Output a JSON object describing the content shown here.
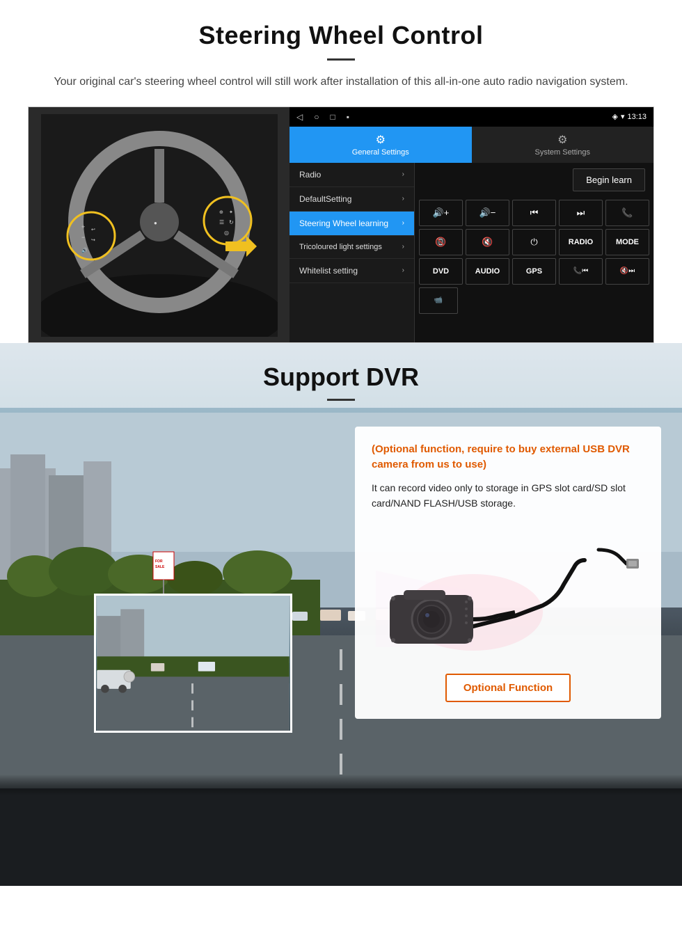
{
  "page": {
    "section1": {
      "title": "Steering Wheel Control",
      "subtitle": "Your original car's steering wheel control will still work after installation of this all-in-one auto radio navigation system.",
      "android_ui": {
        "statusbar": {
          "time": "13:13",
          "signal_icon": "▼",
          "wifi_icon": "▾",
          "battery_icon": "🔋"
        },
        "tabs": [
          {
            "label": "General Settings",
            "icon": "⚙",
            "active": true
          },
          {
            "label": "System Settings",
            "icon": "⚙",
            "active": false
          }
        ],
        "menu_items": [
          {
            "label": "Radio",
            "active": false
          },
          {
            "label": "DefaultSetting",
            "active": false
          },
          {
            "label": "Steering Wheel learning",
            "active": true
          },
          {
            "label": "Tricoloured light settings",
            "active": false
          },
          {
            "label": "Whitelist setting",
            "active": false
          }
        ],
        "begin_learn_label": "Begin learn",
        "controls": [
          [
            "vol+",
            "vol-",
            "prev",
            "next",
            "phone"
          ],
          [
            "hangup",
            "mute",
            "power",
            "RADIO",
            "MODE"
          ],
          [
            "DVD",
            "AUDIO",
            "GPS",
            "phone+prev",
            "mute+next"
          ],
          [
            "dvr_icon"
          ]
        ]
      }
    },
    "section2": {
      "title": "Support DVR",
      "info_card": {
        "optional_text": "(Optional function, require to buy external USB DVR camera from us to use)",
        "description": "It can record video only to storage in GPS slot card/SD slot card/NAND FLASH/USB storage.",
        "optional_function_btn": "Optional Function"
      }
    }
  }
}
